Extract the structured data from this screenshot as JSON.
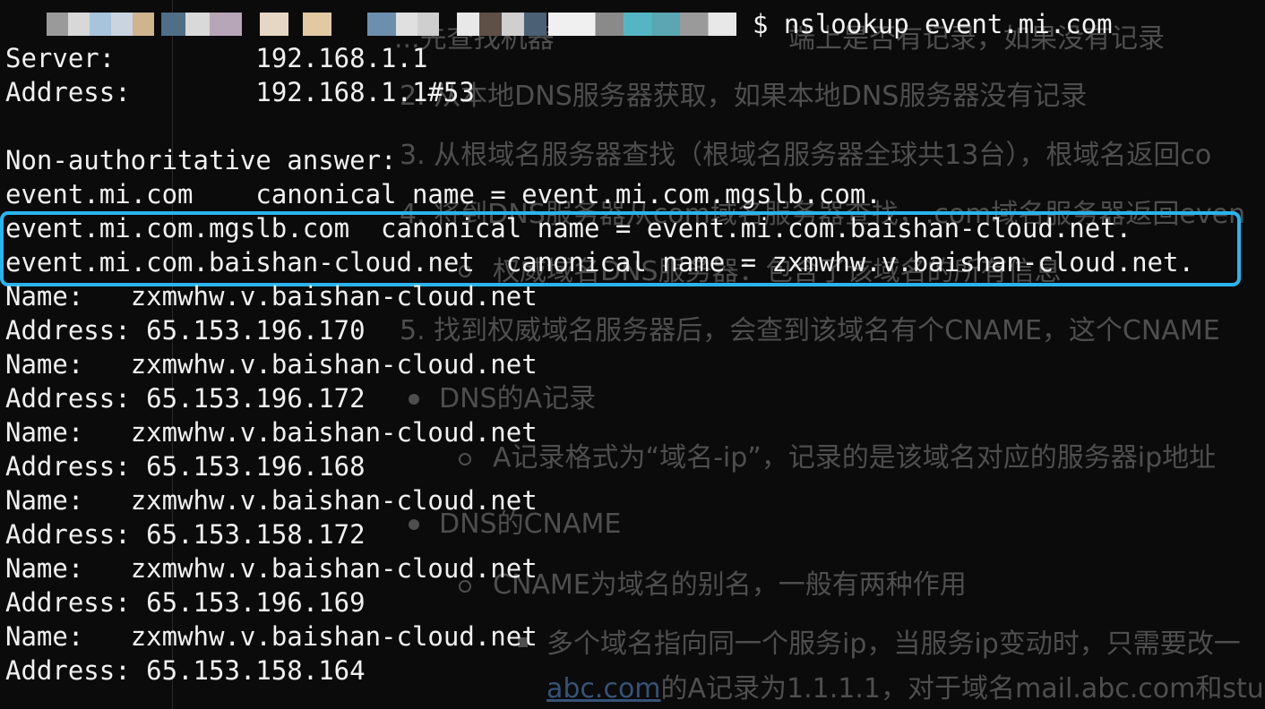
{
  "prompt": {
    "command": "$ nslookup event.mi.com",
    "redacted_fragment": "RELEASE"
  },
  "output": {
    "server_label": "Server:",
    "server_value": "192.168.1.1",
    "address_label": "Address:",
    "address_value": "192.168.1.1#53",
    "non_auth": "Non-authoritative answer:",
    "cname1_host": "event.mi.com",
    "cname1_rest": "canonical name = event.mi.com.mgslb.com.",
    "cname2": "event.mi.com.mgslb.com  canonical name = event.mi.com.baishan-cloud.net.",
    "cname3": "event.mi.com.baishan-cloud.net  canonical name = zxmwhw.v.baishan-cloud.net.",
    "records": [
      {
        "name_label": "Name:",
        "name": "zxmwhw.v.baishan-cloud.net",
        "addr_label": "Address:",
        "addr": "65.153.196.170"
      },
      {
        "name_label": "Name:",
        "name": "zxmwhw.v.baishan-cloud.net",
        "addr_label": "Address:",
        "addr": "65.153.196.172"
      },
      {
        "name_label": "Name:",
        "name": "zxmwhw.v.baishan-cloud.net",
        "addr_label": "Address:",
        "addr": "65.153.196.168"
      },
      {
        "name_label": "Name:",
        "name": "zxmwhw.v.baishan-cloud.net",
        "addr_label": "Address:",
        "addr": "65.153.158.172"
      },
      {
        "name_label": "Name:",
        "name": "zxmwhw.v.baishan-cloud.net",
        "addr_label": "Address:",
        "addr": "65.153.196.169"
      },
      {
        "name_label": "Name:",
        "name": "zxmwhw.v.baishan-cloud.net",
        "addr_label": "Address:",
        "addr": "65.153.158.164"
      }
    ]
  },
  "background_doc": {
    "line1": "...先查找机器",
    "line1b": "端上是否有记录，如果没有记录",
    "item2": "2. 从本地DNS服务器获取，如果本地DNS服务器没有记录",
    "item3": "3.  从根域名服务器查找（根域名服务器全球共13台），根域名返回co",
    "item4": "4. 将到DNS服务器从com域名服务器查找，.com域名服务器返回even",
    "sub4": "权威域名DNS服务器：包含了该域名的所有信息",
    "item5": "5.  找到权威域名服务器后，会查到该域名有个CNAME，这个CNAME",
    "bullet_a": "DNS的A记录",
    "sub_a": "A记录格式为“域名-ip”，记录的是该域名对应的服务器ip地址",
    "bullet_cname": "DNS的CNAME",
    "sub_cname": "CNAME为域名的别名，一般有两种作用",
    "square1": "多个域名指向同一个服务ip，当服务ip变动时，只需要改一",
    "link": "abc.com",
    "line_last": "的A记录为1.1.1.1，对于域名mail.abc.com和stu"
  },
  "colors": {
    "terminal_bg": "#0b0b0b",
    "terminal_fg": "#f1f1f1",
    "highlight": "#2ab4ee",
    "bg_text": "#5a5a5a"
  }
}
